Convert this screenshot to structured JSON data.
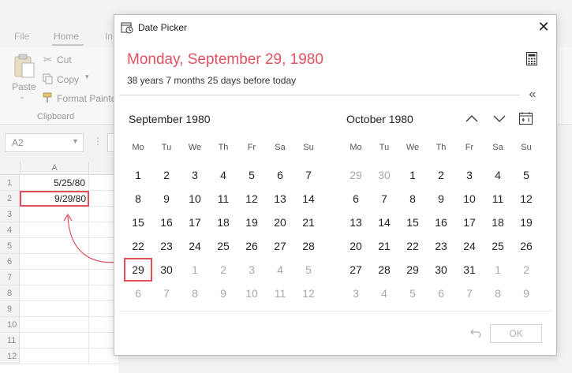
{
  "excel": {
    "tabs": {
      "file": "File",
      "home": "Home",
      "insert_partial": "In"
    },
    "clipboard": {
      "paste": "Paste",
      "cut": "Cut",
      "copy": "Copy",
      "format_painter": "Format Painter",
      "group_label": "Clipboard"
    },
    "name_box": "A2",
    "column_header": "A",
    "rows": [
      {
        "num": "1",
        "value": "5/25/80"
      },
      {
        "num": "2",
        "value": "9/29/80"
      },
      {
        "num": "3",
        "value": ""
      },
      {
        "num": "4",
        "value": ""
      },
      {
        "num": "5",
        "value": ""
      },
      {
        "num": "6",
        "value": ""
      },
      {
        "num": "7",
        "value": ""
      },
      {
        "num": "8",
        "value": ""
      },
      {
        "num": "9",
        "value": ""
      },
      {
        "num": "10",
        "value": ""
      },
      {
        "num": "11",
        "value": ""
      },
      {
        "num": "12",
        "value": ""
      }
    ]
  },
  "dialog": {
    "title": "Date Picker",
    "big_date": "Monday, September 29, 1980",
    "date_diff": "38 years 7 months 25 days before today",
    "collapse_glyph": "«",
    "close_glyph": "✕",
    "ok_label": "OK",
    "weekdays": [
      "Mo",
      "Tu",
      "We",
      "Th",
      "Fr",
      "Sa",
      "Su"
    ],
    "accent_color": "#e0515f",
    "months": [
      {
        "title": "September 1980",
        "weeks": [
          [
            {
              "d": "1"
            },
            {
              "d": "2"
            },
            {
              "d": "3"
            },
            {
              "d": "4"
            },
            {
              "d": "5"
            },
            {
              "d": "6"
            },
            {
              "d": "7"
            }
          ],
          [
            {
              "d": "8"
            },
            {
              "d": "9"
            },
            {
              "d": "10"
            },
            {
              "d": "11"
            },
            {
              "d": "12"
            },
            {
              "d": "13"
            },
            {
              "d": "14"
            }
          ],
          [
            {
              "d": "15"
            },
            {
              "d": "16"
            },
            {
              "d": "17"
            },
            {
              "d": "18"
            },
            {
              "d": "19"
            },
            {
              "d": "20"
            },
            {
              "d": "21"
            }
          ],
          [
            {
              "d": "22"
            },
            {
              "d": "23"
            },
            {
              "d": "24"
            },
            {
              "d": "25"
            },
            {
              "d": "26"
            },
            {
              "d": "27"
            },
            {
              "d": "28"
            }
          ],
          [
            {
              "d": "29",
              "selected": true
            },
            {
              "d": "30"
            },
            {
              "d": "1",
              "muted": true
            },
            {
              "d": "2",
              "muted": true
            },
            {
              "d": "3",
              "muted": true
            },
            {
              "d": "4",
              "muted": true
            },
            {
              "d": "5",
              "muted": true
            }
          ],
          [
            {
              "d": "6",
              "muted": true
            },
            {
              "d": "7",
              "muted": true
            },
            {
              "d": "8",
              "muted": true
            },
            {
              "d": "9",
              "muted": true
            },
            {
              "d": "10",
              "muted": true
            },
            {
              "d": "11",
              "muted": true
            },
            {
              "d": "12",
              "muted": true
            }
          ]
        ]
      },
      {
        "title": "October 1980",
        "weeks": [
          [
            {
              "d": "29",
              "muted": true
            },
            {
              "d": "30",
              "muted": true
            },
            {
              "d": "1"
            },
            {
              "d": "2"
            },
            {
              "d": "3"
            },
            {
              "d": "4"
            },
            {
              "d": "5"
            }
          ],
          [
            {
              "d": "6"
            },
            {
              "d": "7"
            },
            {
              "d": "8"
            },
            {
              "d": "9"
            },
            {
              "d": "10"
            },
            {
              "d": "11"
            },
            {
              "d": "12"
            }
          ],
          [
            {
              "d": "13"
            },
            {
              "d": "14"
            },
            {
              "d": "15"
            },
            {
              "d": "16"
            },
            {
              "d": "17"
            },
            {
              "d": "18"
            },
            {
              "d": "19"
            }
          ],
          [
            {
              "d": "20"
            },
            {
              "d": "21"
            },
            {
              "d": "22"
            },
            {
              "d": "23"
            },
            {
              "d": "24"
            },
            {
              "d": "25"
            },
            {
              "d": "26"
            }
          ],
          [
            {
              "d": "27"
            },
            {
              "d": "28"
            },
            {
              "d": "29"
            },
            {
              "d": "30"
            },
            {
              "d": "31"
            },
            {
              "d": "1",
              "muted": true
            },
            {
              "d": "2",
              "muted": true
            }
          ],
          [
            {
              "d": "3",
              "muted": true
            },
            {
              "d": "4",
              "muted": true
            },
            {
              "d": "5",
              "muted": true
            },
            {
              "d": "6",
              "muted": true
            },
            {
              "d": "7",
              "muted": true
            },
            {
              "d": "8",
              "muted": true
            },
            {
              "d": "9",
              "muted": true
            }
          ]
        ]
      }
    ]
  }
}
